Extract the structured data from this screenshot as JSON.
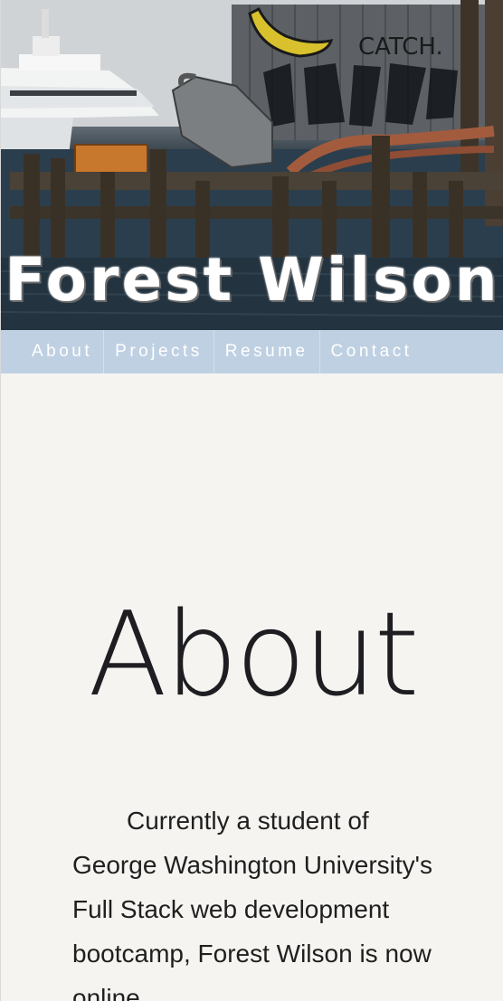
{
  "hero": {
    "title": "Forest Wilson",
    "graffiti_catch": "CATCH."
  },
  "nav": {
    "items": [
      {
        "label": "About"
      },
      {
        "label": "Projects"
      },
      {
        "label": "Resume"
      },
      {
        "label": "Contact"
      }
    ]
  },
  "about": {
    "heading": "About",
    "paragraph": "Currently a student of George Washington University's Full Stack web development bootcamp, Forest Wilson is now online"
  },
  "colors": {
    "nav_background": "#bfd0e2",
    "page_background": "#f5f4f1",
    "text": "#1f1f1f"
  }
}
